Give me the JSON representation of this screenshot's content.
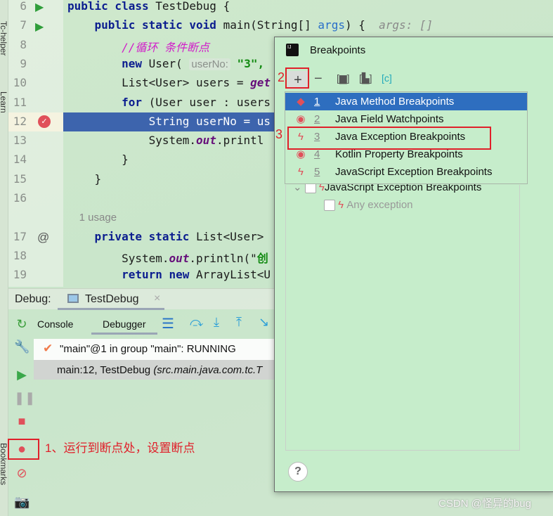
{
  "side_tabs": [
    "Tc-helper",
    "Learn",
    "Bookmarks"
  ],
  "editor": {
    "lines": [
      {
        "n": "6",
        "segs": [
          {
            "t": "public class ",
            "k": "kw"
          },
          {
            "t": "TestDebug {",
            "k": ""
          }
        ]
      },
      {
        "n": "7",
        "segs": [
          {
            "t": "    public static void ",
            "k": "kw"
          },
          {
            "t": "main(String[] ",
            "k": ""
          },
          {
            "t": "args",
            "k": "prm"
          },
          {
            "t": ") {  ",
            "k": ""
          },
          {
            "t": "args: []",
            "k": "ghost"
          }
        ]
      },
      {
        "n": "8",
        "segs": [
          {
            "t": "        //循环 条件断点",
            "k": "cm"
          }
        ]
      },
      {
        "n": "9",
        "segs": [
          {
            "t": "        new ",
            "k": "kw"
          },
          {
            "t": "User( ",
            "k": ""
          },
          {
            "t": "userNo:",
            "k": "hint"
          },
          {
            "t": " \"3\",",
            "k": "str"
          }
        ]
      },
      {
        "n": "10",
        "segs": [
          {
            "t": "        List<User> users = ",
            "k": ""
          },
          {
            "t": "get",
            "k": "it"
          }
        ]
      },
      {
        "n": "11",
        "segs": [
          {
            "t": "        for ",
            "k": "kw"
          },
          {
            "t": "(User user : users",
            "k": ""
          }
        ]
      },
      {
        "n": "12",
        "segs": [
          {
            "t": "            String userNo = us",
            "k": "hlt"
          }
        ]
      },
      {
        "n": "13",
        "segs": [
          {
            "t": "            System.",
            "k": ""
          },
          {
            "t": "out",
            "k": "it"
          },
          {
            "t": ".printl",
            "k": ""
          }
        ]
      },
      {
        "n": "14",
        "segs": [
          {
            "t": "        }",
            "k": ""
          }
        ]
      },
      {
        "n": "15",
        "segs": [
          {
            "t": "    }",
            "k": ""
          }
        ]
      },
      {
        "n": "16",
        "segs": []
      },
      {
        "n": "",
        "segs": [
          {
            "t": "    1 usage",
            "k": "usage"
          }
        ]
      },
      {
        "n": "17",
        "segs": [
          {
            "t": "    private static ",
            "k": "kw"
          },
          {
            "t": "List<User>",
            "k": ""
          }
        ]
      },
      {
        "n": "18",
        "segs": [
          {
            "t": "        System.",
            "k": ""
          },
          {
            "t": "out",
            "k": "it"
          },
          {
            "t": ".println(\"",
            "k": ""
          },
          {
            "t": "创",
            "k": "str"
          }
        ]
      },
      {
        "n": "19",
        "segs": [
          {
            "t": "        return new ",
            "k": "kw"
          },
          {
            "t": "ArrayList<U",
            "k": ""
          }
        ]
      }
    ]
  },
  "debug": {
    "label": "Debug:",
    "session_tab": "TestDebug",
    "tabs": {
      "console": "Console",
      "debugger": "Debugger"
    },
    "thread": "\"main\"@1 in group \"main\": RUNNING",
    "frame": "main:12, TestDebug",
    "frame_path": "(src.main.java.com.tc.T"
  },
  "annotations": {
    "step1": "1、运行到断点处，设置断点",
    "step2": "2",
    "step3": "3"
  },
  "dialog": {
    "title": "Breakpoints",
    "menu": [
      {
        "num": "1",
        "label": "Java Method Breakpoints",
        "icon": "diamond",
        "selected": true
      },
      {
        "num": "2",
        "label": "Java Field Watchpoints",
        "icon": "eye"
      },
      {
        "num": "3",
        "label": "Java Exception Breakpoints",
        "icon": "bolt"
      },
      {
        "num": "4",
        "label": "Kotlin Property Breakpoints",
        "icon": "eye"
      },
      {
        "num": "5",
        "label": "JavaScript Exception Breakpoints",
        "icon": "bolt"
      }
    ],
    "tree": [
      {
        "label": "JavaScript Exception Breakpoints"
      },
      {
        "label": "Any exception"
      }
    ],
    "help": "?"
  },
  "watermark": "CSDN @怪异的bug",
  "colors": {
    "selection": "#2e6ebf",
    "current_line": "#3d64ad",
    "annotation": "#e0202a"
  }
}
